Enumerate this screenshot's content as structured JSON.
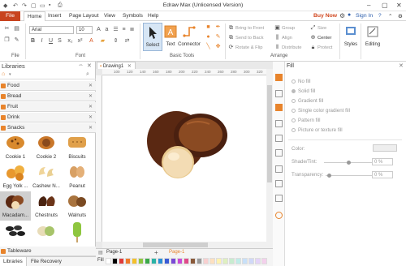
{
  "window": {
    "title": "Edraw Max (Unlicensed Version)"
  },
  "menu": {
    "file": "File",
    "home": "Home",
    "insert": "Insert",
    "page_layout": "Page Layout",
    "view": "View",
    "symbols": "Symbols",
    "help": "Help",
    "buy_now": "Buy Now",
    "sign_in": "Sign In"
  },
  "ribbon": {
    "font_name": "Arial",
    "font_size": "10",
    "group_file": "File",
    "group_font": "Font",
    "group_basic_tools": "Basic Tools",
    "group_arrange": "Arrange",
    "select": "Select",
    "text": "Text",
    "connector": "Connector",
    "bring_to_front": "Bring to Front",
    "send_to_back": "Send to Back",
    "rotate_flip": "Rotate & Flip",
    "group": "Group",
    "align": "Align",
    "distribute": "Distribute",
    "size": "Size",
    "center": "Center",
    "protect": "Protect",
    "styles": "Styles",
    "editing": "Editing"
  },
  "libraries": {
    "title": "Libraries",
    "categories": [
      "Food",
      "Bread",
      "Fruit",
      "Drink",
      "Snacks"
    ],
    "shapes": [
      {
        "label": "Cookie 1"
      },
      {
        "label": "Cookie 2"
      },
      {
        "label": "Biscuits"
      },
      {
        "label": "Egg Yolk ..."
      },
      {
        "label": "Cashew N..."
      },
      {
        "label": "Peanut"
      },
      {
        "label": "Macadam..."
      },
      {
        "label": "Chestnuts"
      },
      {
        "label": "Walnuts"
      },
      {
        "label": ""
      },
      {
        "label": ""
      },
      {
        "label": ""
      }
    ],
    "tableware": "Tableware",
    "tab_libraries": "Libraries",
    "tab_file_recovery": "File Recovery"
  },
  "document": {
    "tab": "Drawing1",
    "page_tab": "Page-1",
    "page_tab_active": "Page-1",
    "ruler_ticks": [
      "100",
      "120",
      "140",
      "160",
      "180",
      "200",
      "220",
      "240",
      "260",
      "280",
      "300",
      "320"
    ],
    "fill_label": "Fill"
  },
  "fill_panel": {
    "title": "Fill",
    "options": [
      "No fill",
      "Solid fill",
      "Gradient fill",
      "Single color gradient fill",
      "Pattern fill",
      "Picture or texture fill"
    ],
    "selected": "Solid fill",
    "color_label": "Color:",
    "shade_label": "Shade/Tint:",
    "shade_value": "0 %",
    "transparency_label": "Transparency:",
    "transparency_value": "0 %"
  },
  "colors": {
    "file_menu": "#c8441f",
    "accent_orange": "#e8842c",
    "nut_dark": "#5a2812",
    "nut_brown": "#8a4a22",
    "nut_cream": "#f3dcb4"
  }
}
